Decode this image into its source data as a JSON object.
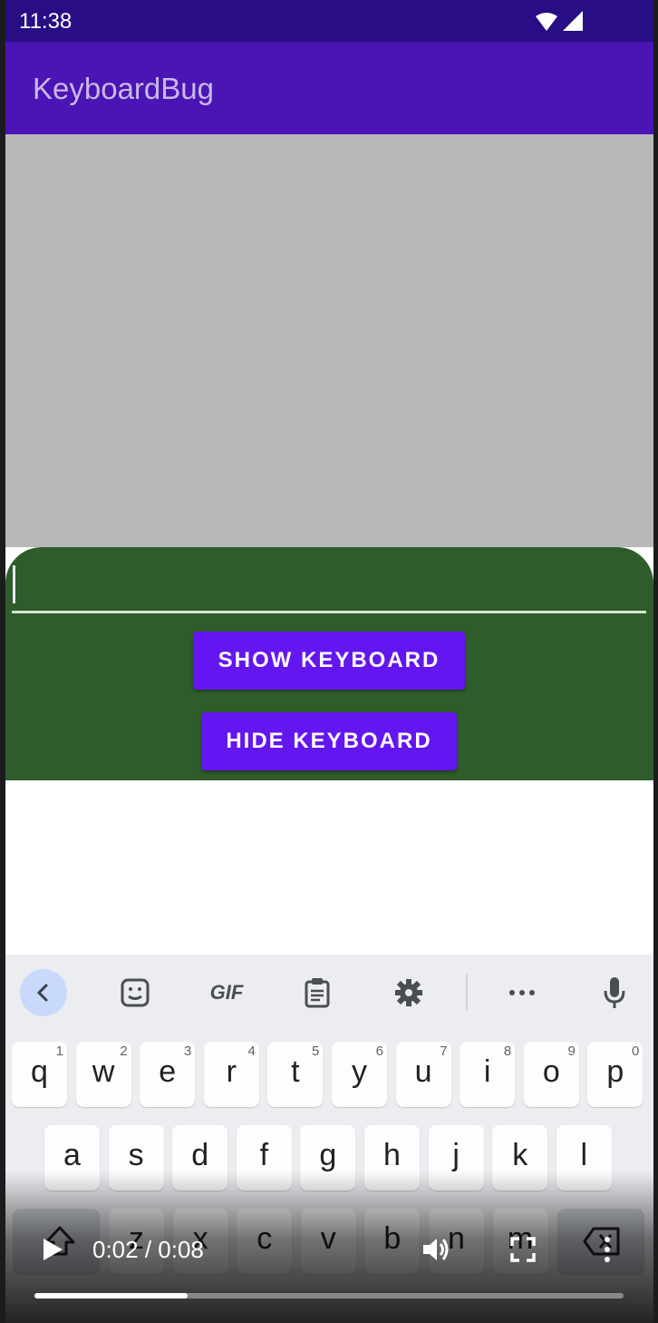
{
  "status_bar": {
    "time": "11:38",
    "icons": [
      "wifi-icon",
      "cell-signal-icon"
    ]
  },
  "app_bar": {
    "title": "KeyboardBug"
  },
  "panel": {
    "input_value": "",
    "show_button_label": "SHOW KEYBOARD",
    "hide_button_label": "HIDE KEYBOARD"
  },
  "keyboard": {
    "toolbar": {
      "items": [
        "back-icon",
        "sticker-icon",
        "GIF",
        "clipboard-icon",
        "settings-icon",
        "more-icon",
        "mic-icon"
      ],
      "gif_label": "GIF"
    },
    "row1": [
      {
        "ch": "q",
        "num": "1"
      },
      {
        "ch": "w",
        "num": "2"
      },
      {
        "ch": "e",
        "num": "3"
      },
      {
        "ch": "r",
        "num": "4"
      },
      {
        "ch": "t",
        "num": "5"
      },
      {
        "ch": "y",
        "num": "6"
      },
      {
        "ch": "u",
        "num": "7"
      },
      {
        "ch": "i",
        "num": "8"
      },
      {
        "ch": "o",
        "num": "9"
      },
      {
        "ch": "p",
        "num": "0"
      }
    ],
    "row2": [
      "a",
      "s",
      "d",
      "f",
      "g",
      "h",
      "j",
      "k",
      "l"
    ],
    "row3": [
      "z",
      "x",
      "c",
      "v",
      "b",
      "n",
      "m"
    ],
    "row3_special": [
      "shift-icon",
      "backspace-icon"
    ]
  },
  "video_controls": {
    "time": "0:02 / 0:08",
    "progress": 0.26,
    "icons": [
      "play-icon",
      "volume-icon",
      "fullscreen-icon",
      "more-vert-icon"
    ]
  },
  "colors": {
    "status_bar": "#280d84",
    "app_bar": "#4b14b4",
    "content": "#b8b8b8",
    "panel": "#2f5c2b",
    "button": "#6316f0",
    "keyboard": "#ecedf1"
  }
}
